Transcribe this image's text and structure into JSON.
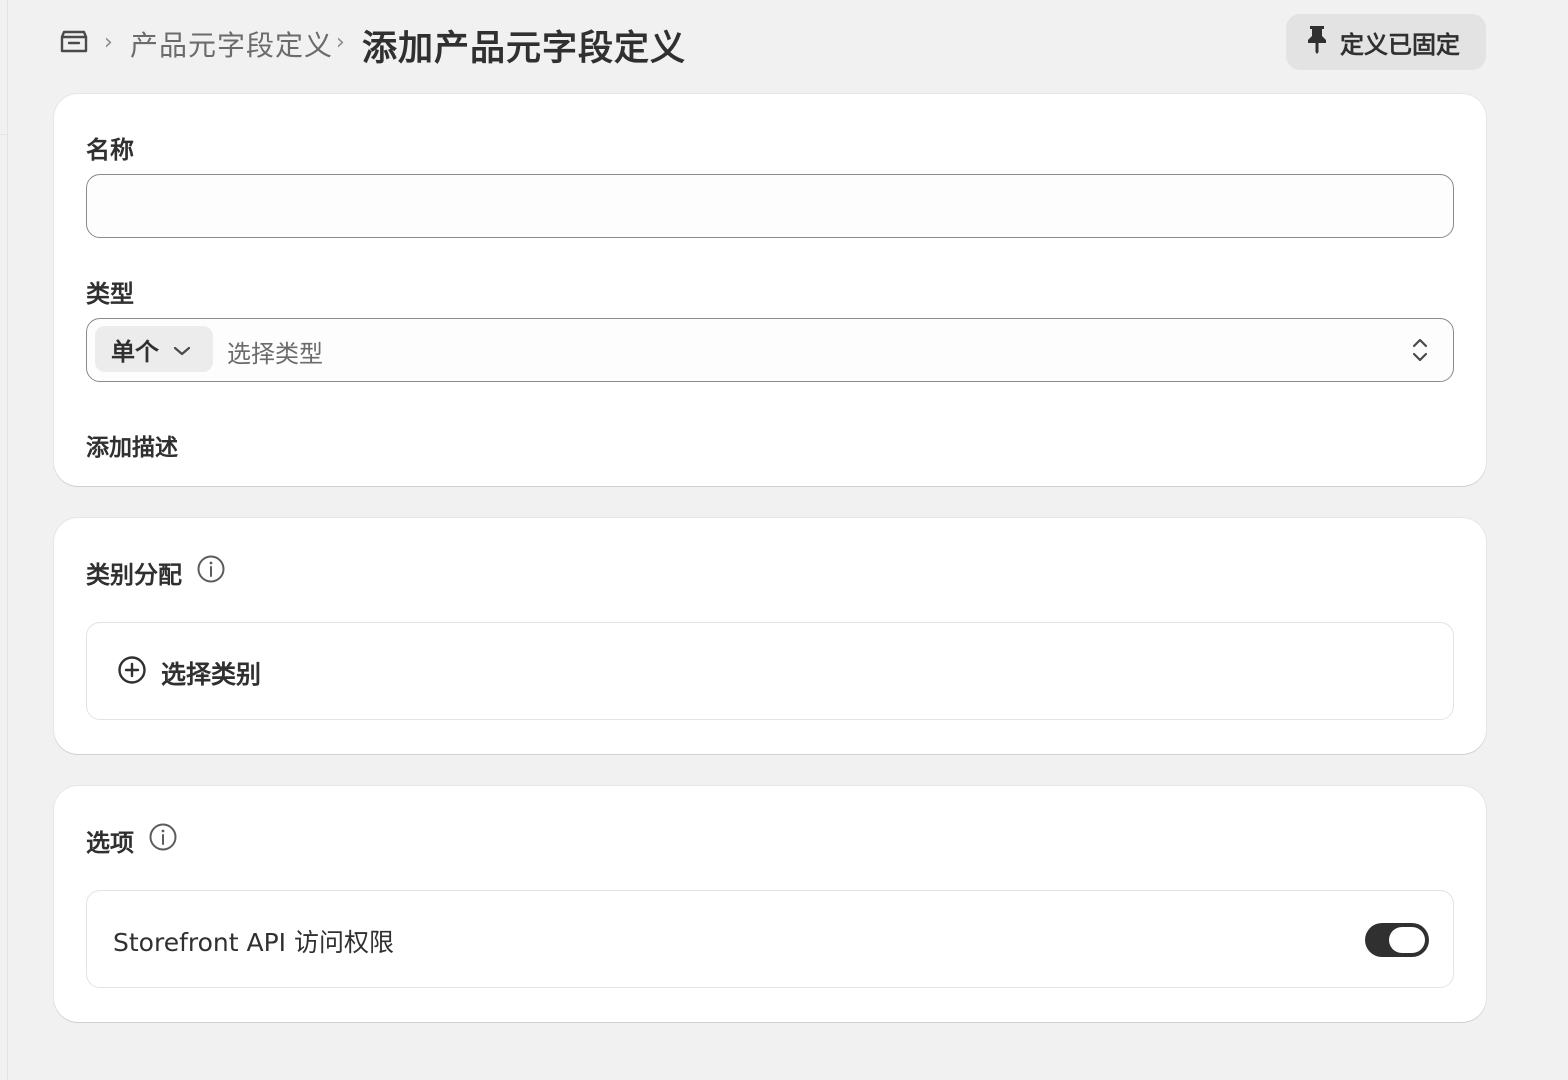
{
  "breadcrumb": {
    "home_icon": "store-icon",
    "parent": "产品元字段定义",
    "separator": "›"
  },
  "page": {
    "title": "添加产品元字段定义"
  },
  "pin_button": {
    "label": "定义已固定",
    "icon": "pin-icon"
  },
  "form": {
    "name_label": "名称",
    "name_value": "",
    "type_label": "类型",
    "cardinality": "单个",
    "type_placeholder": "选择类型",
    "add_description": "添加描述"
  },
  "category": {
    "title": "类别分配",
    "choose_label": "选择类别"
  },
  "options": {
    "title": "选项",
    "storefront_label": "Storefront API 访问权限",
    "storefront_enabled": true
  },
  "colors": {
    "background": "#f1f1f1",
    "card": "#ffffff",
    "text": "#303030",
    "toggle_on": "#303030"
  }
}
